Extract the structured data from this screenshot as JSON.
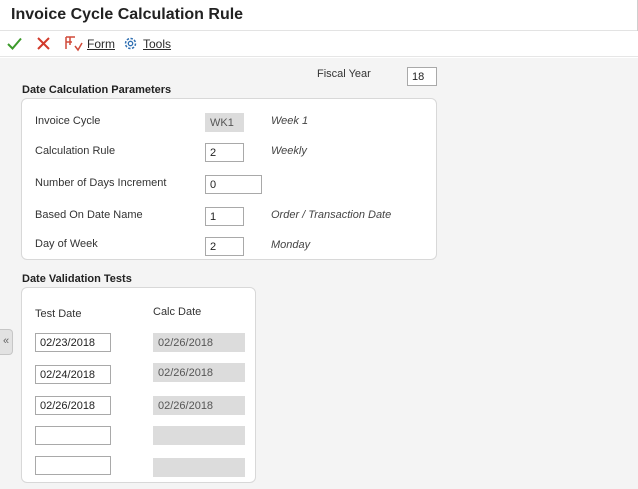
{
  "window": {
    "title": "Invoice Cycle Calculation Rule"
  },
  "toolbar": {
    "ok_icon": "checkmark-icon",
    "cancel_icon": "close-icon",
    "form_icon": "form-icon",
    "form_label": "Form",
    "tools_icon": "gear-icon",
    "tools_label": "Tools"
  },
  "fiscal_year": {
    "label": "Fiscal Year",
    "value": "18"
  },
  "date_calc": {
    "title": "Date Calculation Parameters",
    "invoice_cycle": {
      "label": "Invoice Cycle",
      "value": "WK1",
      "description": "Week 1"
    },
    "calculation_rule": {
      "label": "Calculation Rule",
      "value": "2",
      "description": "Weekly"
    },
    "days_increment": {
      "label": "Number of Days Increment",
      "value": "0"
    },
    "based_on_date": {
      "label": "Based On Date Name",
      "value": "1",
      "description": "Order / Transaction Date"
    },
    "day_of_week": {
      "label": "Day of Week",
      "value": "2",
      "description": "Monday"
    }
  },
  "validation": {
    "title": "Date Validation Tests",
    "test_date_header": "Test Date",
    "calc_date_header": "Calc Date",
    "rows": [
      {
        "test": "02/23/2018",
        "calc": "02/26/2018"
      },
      {
        "test": "02/24/2018",
        "calc": "02/26/2018"
      },
      {
        "test": "02/26/2018",
        "calc": "02/26/2018"
      },
      {
        "test": "",
        "calc": ""
      },
      {
        "test": "",
        "calc": ""
      }
    ]
  },
  "sidebar": {
    "collapse_glyph": "«",
    "collapse_icon": "double-chevron-left-icon"
  },
  "colors": {
    "ok": "#3c9a2a",
    "cancel": "#d23a2b",
    "accent": "#d04a3a",
    "tools": "#2f6fb2"
  }
}
